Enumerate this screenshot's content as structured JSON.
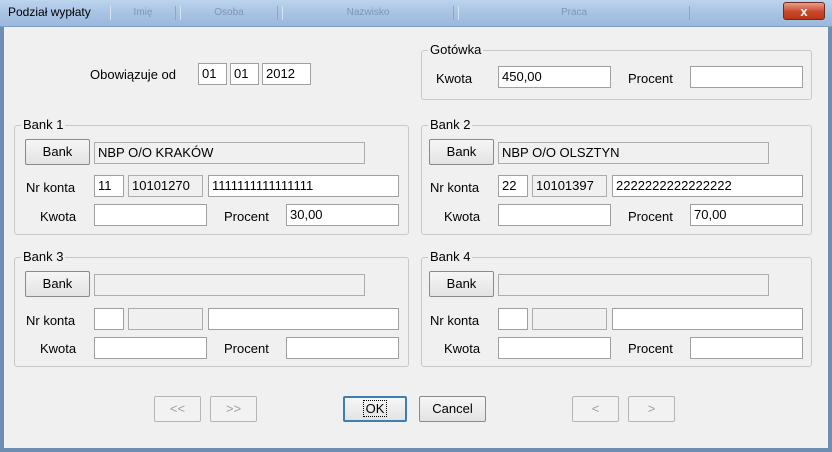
{
  "window": {
    "title": "Podział wypłaty",
    "close_label": "x"
  },
  "background_labels": [
    "Imię",
    "Osoba",
    "Nazwisko",
    "Praca"
  ],
  "effective": {
    "label": "Obowiązuje od",
    "day": "01",
    "month": "01",
    "year": "2012"
  },
  "cash": {
    "title": "Gotówka",
    "amount_label": "Kwota",
    "amount": "450,00",
    "percent_label": "Procent",
    "percent": ""
  },
  "banks": [
    {
      "title": "Bank 1",
      "button": "Bank",
      "name": "NBP O/O KRAKÓW",
      "account_label": "Nr konta",
      "acc1": "11",
      "acc2": "10101270",
      "acc3": "1111111111111111",
      "amount_label": "Kwota",
      "amount": "",
      "percent_label": "Procent",
      "percent": "30,00"
    },
    {
      "title": "Bank 2",
      "button": "Bank",
      "name": "NBP O/O OLSZTYN",
      "account_label": "Nr konta",
      "acc1": "22",
      "acc2": "10101397",
      "acc3": "2222222222222222",
      "amount_label": "Kwota",
      "amount": "",
      "percent_label": "Procent",
      "percent": "70,00"
    },
    {
      "title": "Bank 3",
      "button": "Bank",
      "name": "",
      "account_label": "Nr konta",
      "acc1": "",
      "acc2": "",
      "acc3": "",
      "amount_label": "Kwota",
      "amount": "",
      "percent_label": "Procent",
      "percent": ""
    },
    {
      "title": "Bank 4",
      "button": "Bank",
      "name": "",
      "account_label": "Nr konta",
      "acc1": "",
      "acc2": "",
      "acc3": "",
      "amount_label": "Kwota",
      "amount": "",
      "percent_label": "Procent",
      "percent": ""
    }
  ],
  "footer": {
    "first": "<<",
    "prev_page": ">>",
    "ok": "OK",
    "cancel": "Cancel",
    "prev": "<",
    "next": ">"
  }
}
